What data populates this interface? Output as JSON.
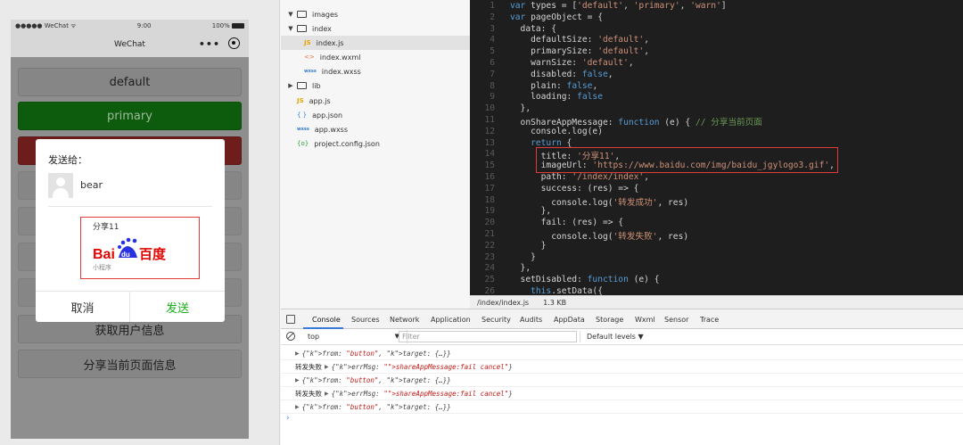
{
  "simulator": {
    "status_left": "●●●●● WeChat ᯤ",
    "status_time": "9:00",
    "status_battery": "100%",
    "nav_title": "WeChat",
    "nav_more": "•••",
    "buttons": {
      "default": "default",
      "primary": "primary",
      "userinfo": "获取用户信息",
      "pageinfo": "分享当前页面信息"
    },
    "share_modal": {
      "to_label": "发送给：",
      "user_name": "bear",
      "card_title": "分享11",
      "card_subtitle": "小程序",
      "logo_text_left": "Bai",
      "logo_text_mid": "du",
      "logo_text_right": "百度",
      "cancel": "取消",
      "send": "发送",
      "card_border_color": "#e03c3c",
      "send_color": "#1aad19"
    }
  },
  "file_tree": [
    {
      "name": "images",
      "type": "folder",
      "arrow": "▼",
      "indent": 0
    },
    {
      "name": "index",
      "type": "folder",
      "arrow": "▼",
      "indent": 0
    },
    {
      "name": "index.js",
      "type": "js",
      "icon": "JS",
      "indent": 1,
      "selected": true
    },
    {
      "name": "index.wxml",
      "type": "wxml",
      "icon": "<>",
      "indent": 1
    },
    {
      "name": "index.wxss",
      "type": "wxss",
      "icon": "wxss",
      "indent": 1
    },
    {
      "name": "lib",
      "type": "folder",
      "arrow": "▶",
      "indent": 0
    },
    {
      "name": "app.js",
      "type": "js",
      "icon": "JS",
      "indent": 0
    },
    {
      "name": "app.json",
      "type": "json",
      "icon": "{ }",
      "indent": 0
    },
    {
      "name": "app.wxss",
      "type": "wxss",
      "icon": "wxss",
      "indent": 0
    },
    {
      "name": "project.config.json",
      "type": "cfg",
      "icon": "{o}",
      "indent": 0
    }
  ],
  "editor": {
    "lines": [
      [
        [
          "kw",
          "var "
        ],
        [
          "pl",
          "types = ["
        ],
        [
          "st",
          "'default'"
        ],
        [
          "pl",
          ", "
        ],
        [
          "st",
          "'primary'"
        ],
        [
          "pl",
          ", "
        ],
        [
          "st",
          "'warn'"
        ],
        [
          "pl",
          "]"
        ]
      ],
      [
        [
          "kw",
          "var "
        ],
        [
          "pl",
          "pageObject = {"
        ]
      ],
      [
        [
          "pl",
          "  data: {"
        ]
      ],
      [
        [
          "pl",
          "    defaultSize: "
        ],
        [
          "st",
          "'default'"
        ],
        [
          "pl",
          ","
        ]
      ],
      [
        [
          "pl",
          "    primarySize: "
        ],
        [
          "st",
          "'default'"
        ],
        [
          "pl",
          ","
        ]
      ],
      [
        [
          "pl",
          "    warnSize: "
        ],
        [
          "st",
          "'default'"
        ],
        [
          "pl",
          ","
        ]
      ],
      [
        [
          "pl",
          "    disabled: "
        ],
        [
          "kw",
          "false"
        ],
        [
          "pl",
          ","
        ]
      ],
      [
        [
          "pl",
          "    plain: "
        ],
        [
          "kw",
          "false"
        ],
        [
          "pl",
          ","
        ]
      ],
      [
        [
          "pl",
          "    loading: "
        ],
        [
          "kw",
          "false"
        ]
      ],
      [
        [
          "pl",
          "  },"
        ]
      ],
      [
        [
          "pl",
          "  onShareAppMessage: "
        ],
        [
          "kw",
          "function "
        ],
        [
          "pl",
          "(e) { "
        ],
        [
          "cm",
          "// 分享当前页面"
        ]
      ],
      [
        [
          "pl",
          "    console.log(e)"
        ]
      ],
      [
        [
          "kw",
          "    return "
        ],
        [
          "pl",
          "{"
        ]
      ],
      [
        [
          "pl",
          "      title: "
        ],
        [
          "st",
          "'分享11'"
        ],
        [
          "pl",
          ","
        ]
      ],
      [
        [
          "pl",
          "      imageUrl: "
        ],
        [
          "st",
          "'https://www.baidu.com/img/baidu_jgylogo3.gif'"
        ],
        [
          "pl",
          ","
        ]
      ],
      [
        [
          "pl",
          "      path: "
        ],
        [
          "st",
          "'/index/index'"
        ],
        [
          "pl",
          ","
        ]
      ],
      [
        [
          "pl",
          "      success: (res) => {"
        ]
      ],
      [
        [
          "pl",
          "        console.log("
        ],
        [
          "st",
          "'转发成功'"
        ],
        [
          "pl",
          ", res)"
        ]
      ],
      [
        [
          "pl",
          "      },"
        ]
      ],
      [
        [
          "pl",
          "      fail: (res) => {"
        ]
      ],
      [
        [
          "pl",
          "        console.log("
        ],
        [
          "st",
          "'转发失败'"
        ],
        [
          "pl",
          ", res)"
        ]
      ],
      [
        [
          "pl",
          "      }"
        ]
      ],
      [
        [
          "pl",
          "    }"
        ]
      ],
      [
        [
          "pl",
          "  },"
        ]
      ],
      [
        [
          "pl",
          "  setDisabled: "
        ],
        [
          "kw",
          "function "
        ],
        [
          "pl",
          "(e) {"
        ]
      ],
      [
        [
          "kw",
          "    this"
        ],
        [
          "pl",
          ".setData({"
        ]
      ]
    ],
    "highlight_color": "#e03c3c",
    "status_path": "/index/index.js",
    "status_size": "1.3 KB"
  },
  "devtools": {
    "tabs": [
      "Console",
      "Sources",
      "Network",
      "Application",
      "Security",
      "Audits",
      "AppData",
      "Storage",
      "Wxml",
      "Sensor",
      "Trace"
    ],
    "active_tab": "Console",
    "context": "top",
    "filter_placeholder": "Filter",
    "levels": "Default levels ▼",
    "console_rows": [
      {
        "label": "",
        "text": "{from: \"button\", target: {…}}"
      },
      {
        "label": "转发失败",
        "text": "{errMsg: \"shareAppMessage:fail cancel\"}"
      },
      {
        "label": "",
        "text": "{from: \"button\", target: {…}}"
      },
      {
        "label": "转发失败",
        "text": "{errMsg: \"shareAppMessage:fail cancel\"}"
      },
      {
        "label": "",
        "text": "{from: \"button\", target: {…}}"
      }
    ],
    "prompt": "›"
  }
}
